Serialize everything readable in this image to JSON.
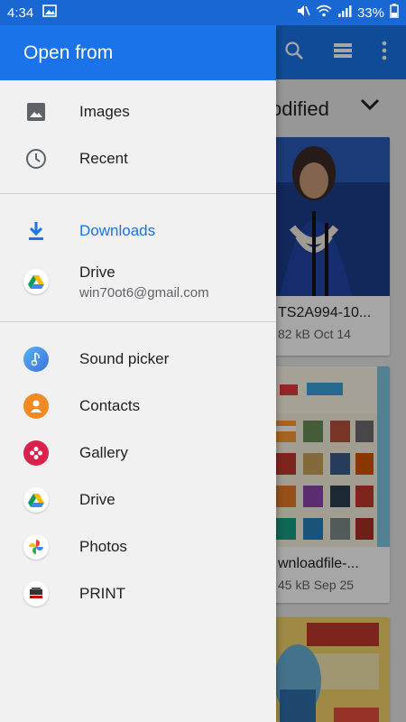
{
  "status_bar": {
    "time": "4:34",
    "battery": "33%"
  },
  "background": {
    "sort_label": "odified",
    "files": [
      {
        "name": "TS2A994-10...",
        "meta": "82 kB Oct 14"
      },
      {
        "name": "wnloadfile-...",
        "meta": "45 kB Sep 25"
      }
    ]
  },
  "drawer": {
    "title": "Open from",
    "items_top": [
      {
        "label": "Images",
        "icon": "image-icon"
      },
      {
        "label": "Recent",
        "icon": "clock-icon"
      }
    ],
    "items_mid": [
      {
        "label": "Downloads",
        "icon": "download-icon"
      },
      {
        "label": "Drive",
        "sub": "win70ot6@gmail.com",
        "icon": "drive-icon"
      }
    ],
    "items_apps": [
      {
        "label": "Sound picker",
        "icon": "music-note-icon"
      },
      {
        "label": "Contacts",
        "icon": "contacts-icon"
      },
      {
        "label": "Gallery",
        "icon": "gallery-icon"
      },
      {
        "label": "Drive",
        "icon": "drive-icon"
      },
      {
        "label": "Photos",
        "icon": "photos-icon"
      },
      {
        "label": "PRINT",
        "icon": "canon-print-icon"
      }
    ]
  },
  "colors": {
    "accent": "#1a73e8",
    "status_bar": "#1967d2"
  }
}
